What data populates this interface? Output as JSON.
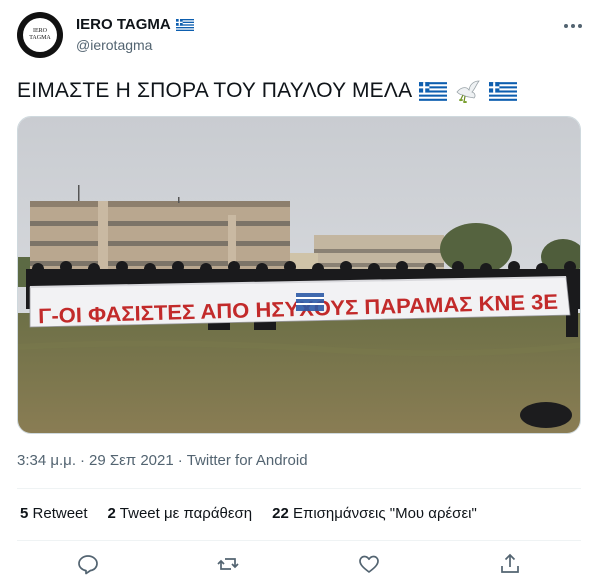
{
  "author": {
    "display_name": "IERO TAGMA",
    "handle": "@ierotagma",
    "avatar_text_line1": "IERO",
    "avatar_text_line2": "TAGMA"
  },
  "tweet": {
    "text": "ΕΙΜΑΣΤΕ Η ΣΠΟΡΑ ΤΟΥ ΠΑΥΛΟΥ ΜΕΛΑ",
    "banner_text": "Γ-ΟΙ ΦΑΣΙΣΤΕΣ ΑΠΟ ΗΣΥΧΟΥΣ ΠΑΡΑΜΑΣ ΚΝΕ 3Ε"
  },
  "meta": {
    "time": "3:34 μ.μ.",
    "date": "29 Σεπ 2021",
    "separator": "·",
    "source": "Twitter for Android"
  },
  "stats": {
    "retweets_count": "5",
    "retweets_label": "Retweet",
    "quotes_count": "2",
    "quotes_label": "Tweet με παράθεση",
    "likes_count": "22",
    "likes_label": "Επισημάνσεις \"Μου αρέσει\""
  },
  "icons": [
    "more-icon",
    "reply-icon",
    "retweet-icon",
    "like-icon",
    "share-icon",
    "greek-flag-icon",
    "dove-icon"
  ],
  "colors": {
    "secondary_text": "#536471",
    "icon": "#536471",
    "divider": "#eff3f4",
    "flag_blue": "#0d5eaf"
  }
}
